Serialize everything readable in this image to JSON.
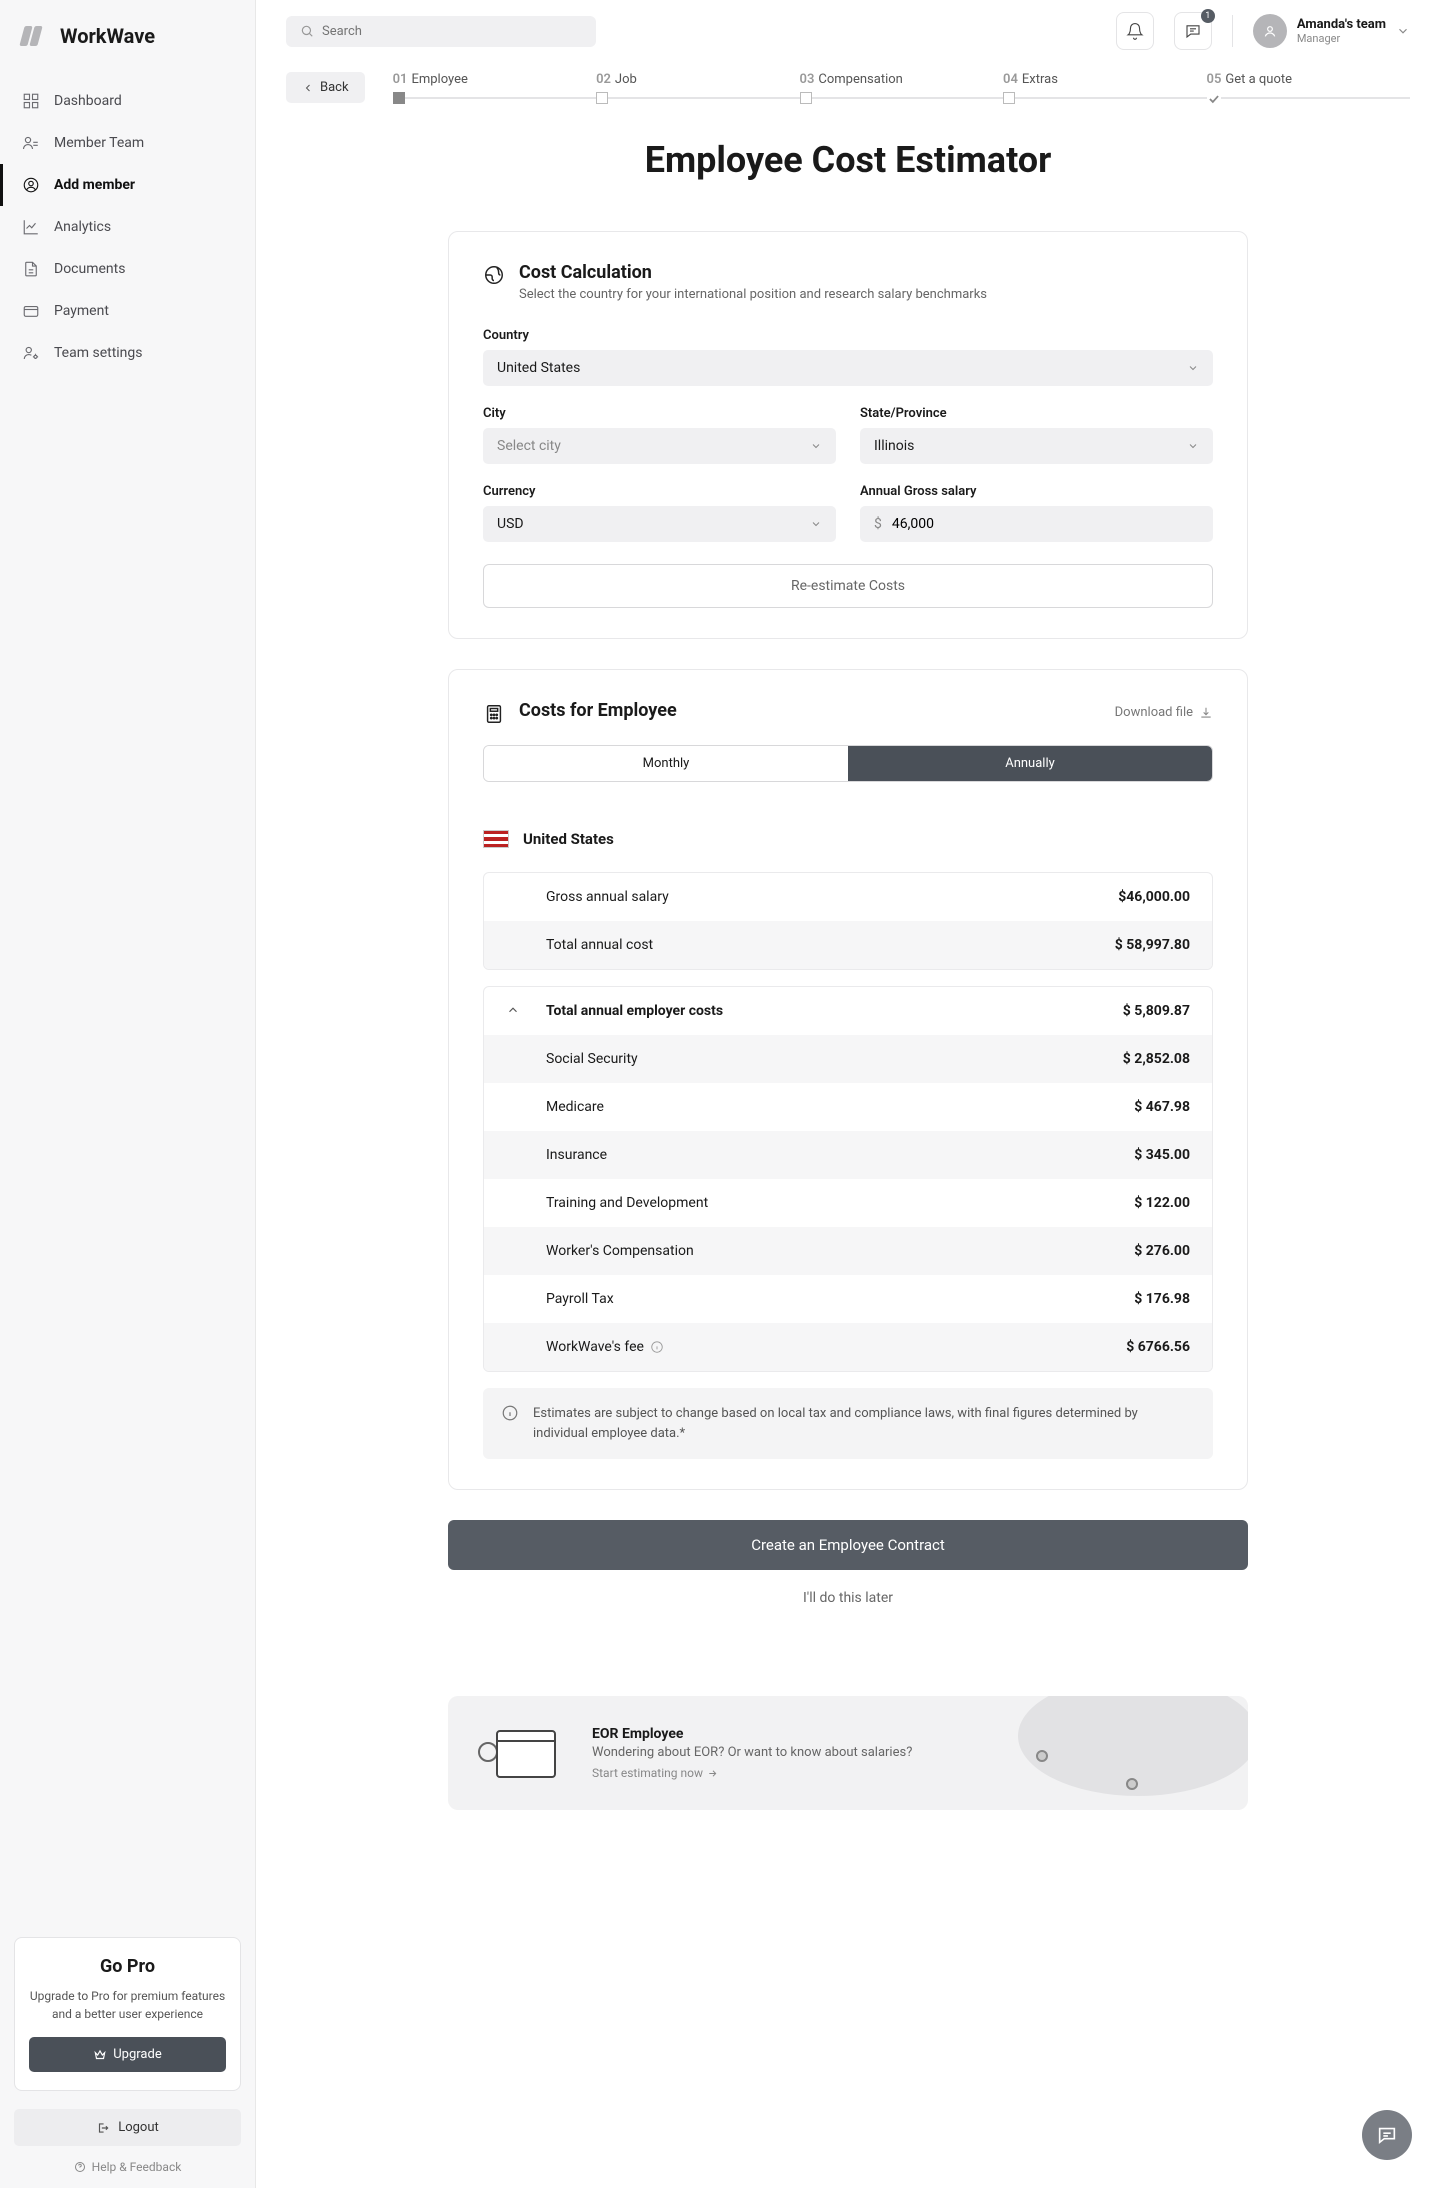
{
  "brand": "WorkWave",
  "search": {
    "placeholder": "Search"
  },
  "msg_badge": "1",
  "user": {
    "name": "Amanda's team",
    "role": "Manager"
  },
  "nav": [
    {
      "label": "Dashboard"
    },
    {
      "label": "Member Team"
    },
    {
      "label": "Add member"
    },
    {
      "label": "Analytics"
    },
    {
      "label": "Documents"
    },
    {
      "label": "Payment"
    },
    {
      "label": "Team settings"
    }
  ],
  "pro": {
    "title": "Go Pro",
    "desc": "Upgrade to Pro for premium features and a better user experience",
    "btn": "Upgrade"
  },
  "logout": "Logout",
  "help": "Help & Feedback",
  "back": "Back",
  "steps": [
    {
      "num": "01",
      "label": "Employee"
    },
    {
      "num": "02",
      "label": "Job"
    },
    {
      "num": "03",
      "label": "Compensation"
    },
    {
      "num": "04",
      "label": "Extras"
    },
    {
      "num": "05",
      "label": "Get a quote"
    }
  ],
  "page_title": "Employee Cost Estimator",
  "calc": {
    "title": "Cost Calculation",
    "sub": "Select the country for your international position and research salary benchmarks",
    "country_label": "Country",
    "country": "United States",
    "city_label": "City",
    "city": "Select city",
    "state_label": "State/Province",
    "state": "Illinois",
    "currency_label": "Currency",
    "currency": "USD",
    "salary_label": "Annual Gross salary",
    "salary_prefix": "$",
    "salary": "46,000",
    "reestimate": "Re-estimate Costs"
  },
  "costs": {
    "title": "Costs for Employee",
    "download": "Download file",
    "tab_monthly": "Monthly",
    "tab_annually": "Annually",
    "country": "United States",
    "summary": [
      {
        "label": "Gross annual salary",
        "value": "$46,000.00"
      },
      {
        "label": "Total annual cost",
        "value": "$ 58,997.80"
      }
    ],
    "employer_head": {
      "label": "Total annual employer costs",
      "value": "$ 5,809.87"
    },
    "employer_items": [
      {
        "label": "Social Security",
        "value": "$ 2,852.08"
      },
      {
        "label": "Medicare",
        "value": "$ 467.98"
      },
      {
        "label": "Insurance",
        "value": "$ 345.00"
      },
      {
        "label": "Training and Development",
        "value": "$ 122.00"
      },
      {
        "label": "Worker's Compensation",
        "value": "$ 276.00"
      },
      {
        "label": "Payroll Tax",
        "value": "$ 176.98"
      },
      {
        "label": "WorkWave's fee",
        "value": "$ 6766.56",
        "info": true
      }
    ],
    "disclaimer": "Estimates are subject to change based on local tax and compliance laws, with final figures determined by individual employee data.*"
  },
  "actions": {
    "primary": "Create an Employee Contract",
    "later": "I'll do this later"
  },
  "promo": {
    "title": "EOR Employee",
    "desc": "Wondering about EOR? Or want to know about salaries?",
    "link": "Start estimating now"
  }
}
